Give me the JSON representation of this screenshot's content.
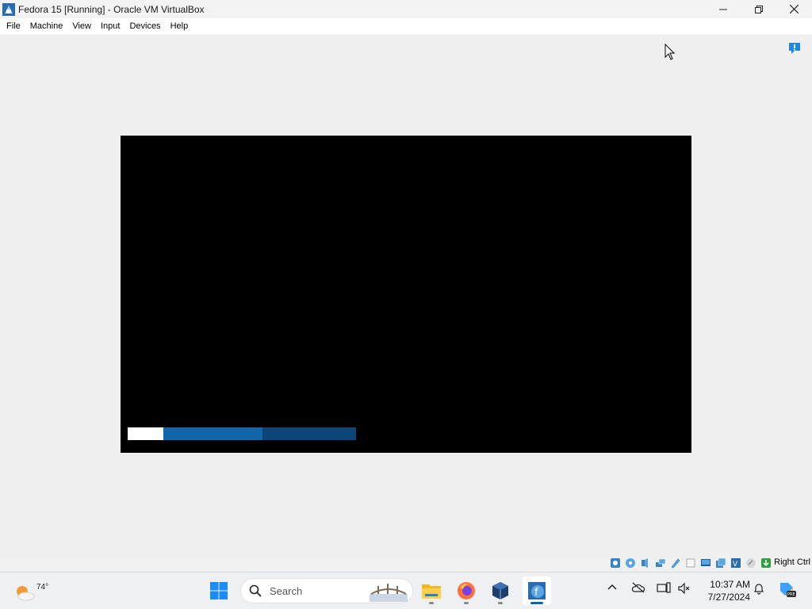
{
  "window": {
    "title": "Fedora 15 [Running] - Oracle VM VirtualBox"
  },
  "menu": [
    "File",
    "Machine",
    "View",
    "Input",
    "Devices",
    "Help"
  ],
  "guest": {
    "boot_progress": {
      "white_fraction": 0.155,
      "blue_fraction": 0.59,
      "colors": {
        "white": "#ffffff",
        "blue": "#1066a8",
        "track": "#0c4577"
      }
    }
  },
  "statusbar": {
    "icons": [
      "hard-disk-icon",
      "optical-drive-icon",
      "audio-icon",
      "network-icon",
      "usb-icon",
      "shared-folders-icon",
      "display-icon",
      "video-capture-icon",
      "cpu-virtualization-icon",
      "mouse-integration-icon",
      "host-key-icon"
    ],
    "host_key": "Right Ctrl"
  },
  "taskbar": {
    "weather": {
      "temp": "74°"
    },
    "search_placeholder": "Search",
    "apps": [
      "start-button",
      "file-explorer",
      "firefox",
      "virtualbox",
      "fedora-vm"
    ],
    "clock": {
      "time": "10:37 AM",
      "date": "7/27/2024"
    }
  }
}
